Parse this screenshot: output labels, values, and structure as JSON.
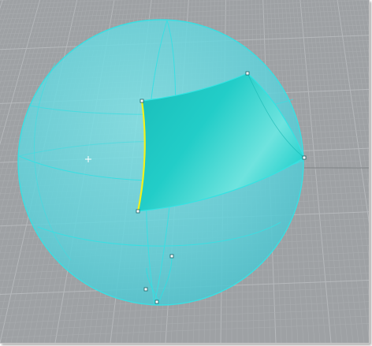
{
  "viewport": {
    "view": "perspective",
    "display_mode": "ghosted",
    "grid": true,
    "grid_major_every": 10
  },
  "scene": {
    "objects": [
      {
        "name": "sphere",
        "kind": "surface",
        "appearance": "translucent-cyan"
      },
      {
        "name": "extracted-patch",
        "kind": "surface",
        "appearance": "solid-cyan",
        "selected_edge": "left"
      }
    ]
  },
  "colors": {
    "background": "#9ea1a4",
    "grid_minor": "#a9acaf",
    "grid_major": "#b6b9bc",
    "sphere_fill": "#5fd4dc",
    "wire": "#34dde0",
    "patch": "#1fc9c5",
    "selection": "#f2f21e",
    "point": "#ffffff"
  },
  "icons": [
    "origin-marker-icon"
  ]
}
